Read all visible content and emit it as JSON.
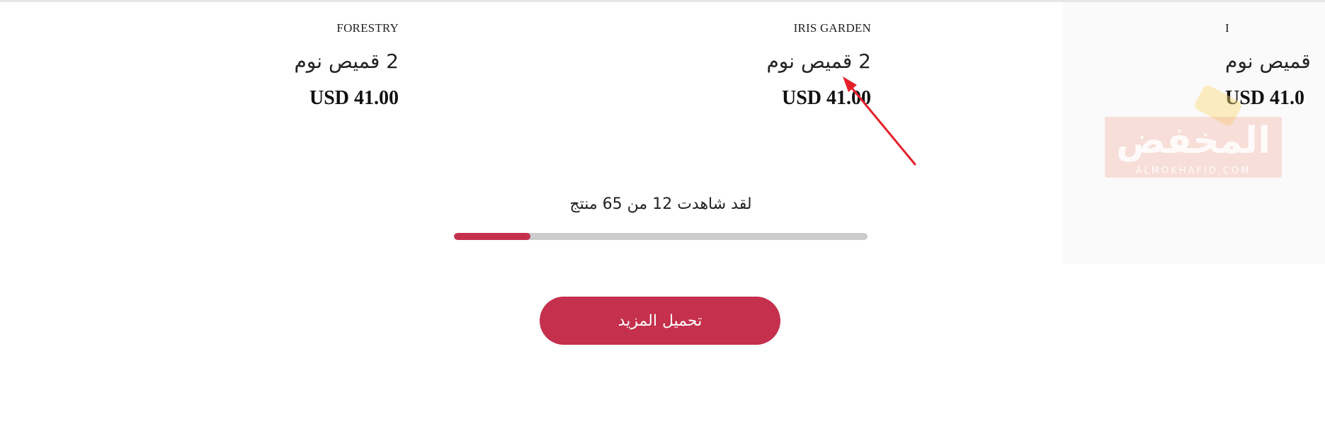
{
  "products": [
    {
      "brand": "FORESTRY",
      "name": "2 قميص نوم",
      "price": "USD 41.00"
    },
    {
      "brand": "IRIS GARDEN",
      "name": "2 قميص نوم",
      "price": "USD 41.00"
    },
    {
      "brand": "I",
      "name": "قميص نوم",
      "price": "USD 41.0"
    }
  ],
  "pagination": {
    "status_text": "لقد شاهدت 12 من 65 منتج",
    "viewed": 12,
    "total": 65,
    "load_more_label": "تحميل المزيد"
  },
  "watermark": {
    "text": "المخفض",
    "subtext": "ALMOKHAFID.COM"
  },
  "colors": {
    "accent": "#c5304c",
    "track": "#cccccc",
    "annotation_arrow": "#e3202a"
  }
}
